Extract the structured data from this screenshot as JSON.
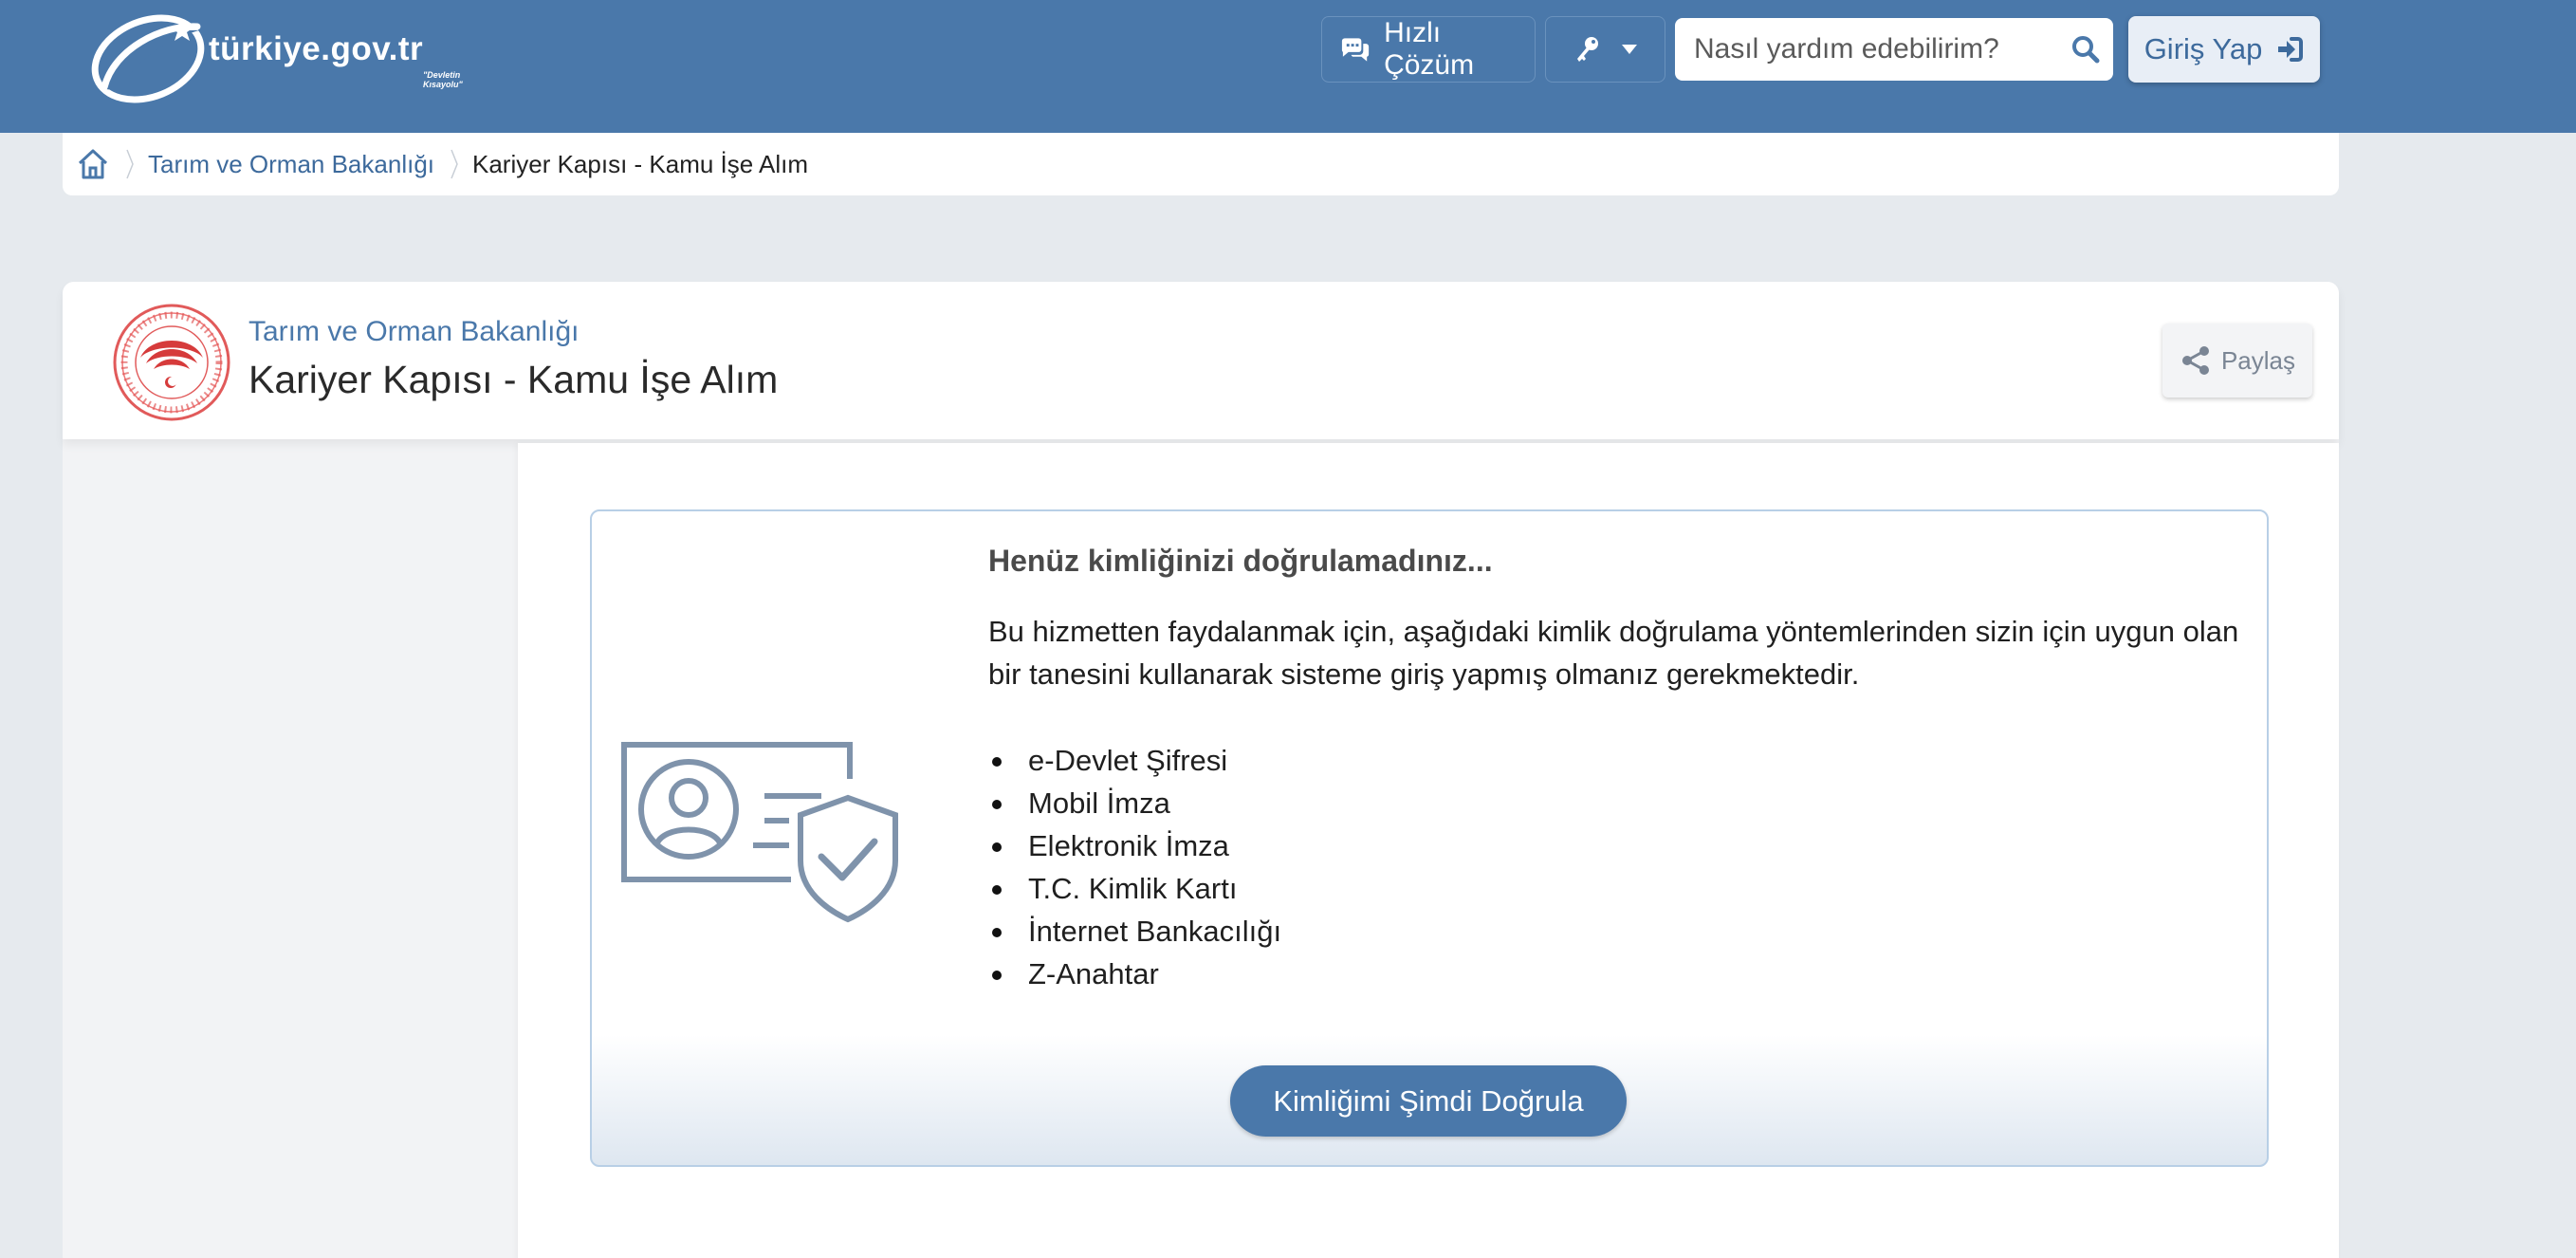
{
  "header": {
    "logo_text": "türkiye.gov.tr",
    "logo_tagline": "\"Devletin Kısayolu\"",
    "quick_solution_label": "Hızlı Çözüm",
    "search_placeholder": "Nasıl yardım edebilirim?",
    "login_label": "Giriş Yap",
    "accent_color": "#4a78aa"
  },
  "breadcrumb": {
    "items": [
      {
        "label": "Tarım ve Orman Bakanlığı",
        "icon": "home-icon"
      },
      {
        "label": "Kariyer Kapısı - Kamu İşe Alım"
      }
    ]
  },
  "service": {
    "org_name": "Tarım ve Orman Bakanlığı",
    "title": "Kariyer Kapısı - Kamu İşe Alım",
    "share_label": "Paylaş"
  },
  "verification": {
    "heading": "Henüz kimliğinizi doğrulamadınız...",
    "description": "Bu hizmetten faydalanmak için, aşağıdaki kimlik doğrulama yöntemlerinden sizin için uygun olan bir tanesini kullanarak sisteme giriş yapmış olmanız gerekmektedir.",
    "methods": [
      "e-Devlet Şifresi",
      "Mobil İmza",
      "Elektronik İmza",
      "T.C. Kimlik Kartı",
      "İnternet Bankacılığı",
      "Z-Anahtar"
    ],
    "button_label": "Kimliğimi Şimdi Doğrula"
  }
}
